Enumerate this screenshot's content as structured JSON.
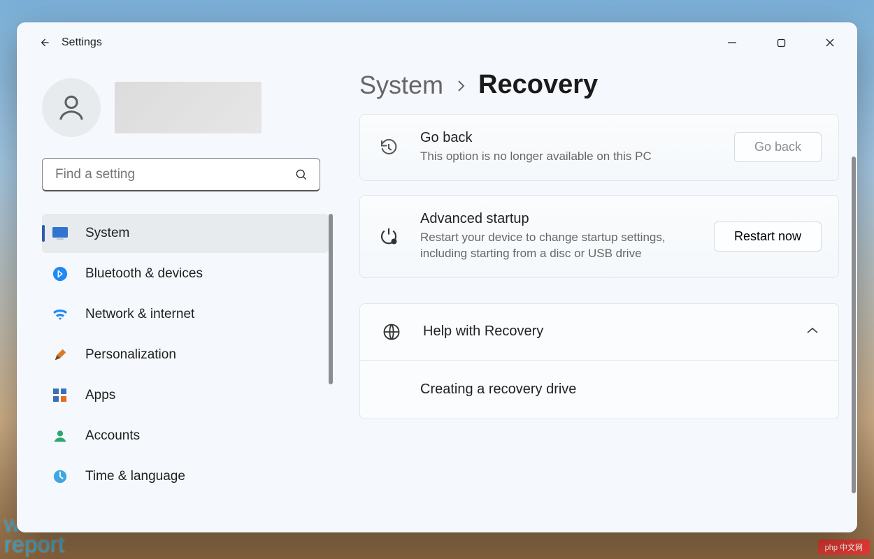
{
  "app": {
    "title": "Settings"
  },
  "search": {
    "placeholder": "Find a setting"
  },
  "sidebar": {
    "items": [
      {
        "label": "System"
      },
      {
        "label": "Bluetooth & devices"
      },
      {
        "label": "Network & internet"
      },
      {
        "label": "Personalization"
      },
      {
        "label": "Apps"
      },
      {
        "label": "Accounts"
      },
      {
        "label": "Time & language"
      }
    ]
  },
  "breadcrumb": {
    "parent": "System",
    "current": "Recovery"
  },
  "cards": {
    "goback": {
      "title": "Go back",
      "desc": "This option is no longer available on this PC",
      "button": "Go back"
    },
    "advanced": {
      "title": "Advanced startup",
      "desc": "Restart your device to change startup settings, including starting from a disc or USB drive",
      "button": "Restart now"
    }
  },
  "help": {
    "title": "Help with Recovery",
    "link1": "Creating a recovery drive"
  },
  "watermark": {
    "line1": "windows",
    "line2": "report"
  },
  "badge": "php 中文网"
}
